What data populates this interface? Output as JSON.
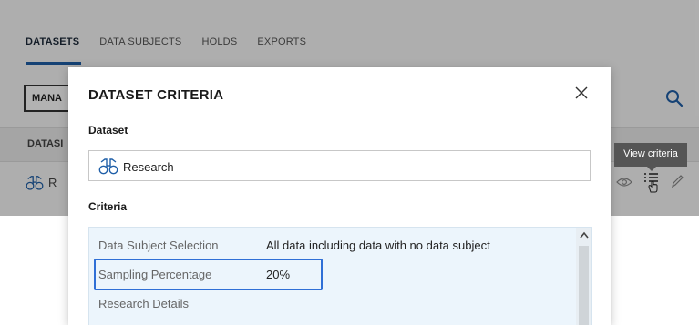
{
  "tabs": [
    "DATASETS",
    "DATA SUBJECTS",
    "HOLDS",
    "EXPORTS"
  ],
  "background": {
    "manage_button": "MANA",
    "table_header": "DATASI",
    "row_label": "R",
    "tooltip": "View criteria"
  },
  "dialog": {
    "title": "DATASET CRITERIA",
    "dataset_label": "Dataset",
    "dataset_value": "Research",
    "criteria_label": "Criteria",
    "criteria": [
      {
        "key": "Data Subject Selection",
        "value": "All data including data with no data subject"
      },
      {
        "key": "Sampling Percentage",
        "value": "20%"
      },
      {
        "key": "Research Details",
        "value": ""
      }
    ]
  },
  "colors": {
    "accent": "#1f5fa8",
    "highlight_border": "#2f6fd6",
    "criteria_bg": "#ecf5fc"
  },
  "icons": [
    "search-icon",
    "binoculars-icon",
    "eye-icon",
    "view-criteria-icon",
    "pencil-icon",
    "close-icon",
    "scroll-up-icon"
  ]
}
